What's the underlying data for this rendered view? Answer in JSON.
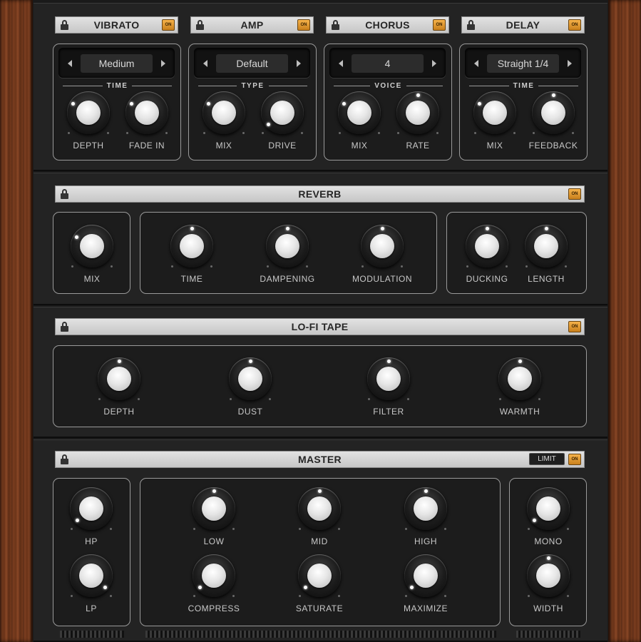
{
  "modules": {
    "vibrato": {
      "title": "VIBRATO",
      "on": "ON",
      "selector": "Medium",
      "group": "TIME",
      "knob1": "DEPTH",
      "knob2": "FADE IN"
    },
    "amp": {
      "title": "AMP",
      "on": "ON",
      "selector": "Default",
      "group": "TYPE",
      "knob1": "MIX",
      "knob2": "DRIVE"
    },
    "chorus": {
      "title": "CHORUS",
      "on": "ON",
      "selector": "4",
      "group": "VOICE",
      "knob1": "MIX",
      "knob2": "RATE"
    },
    "delay": {
      "title": "DELAY",
      "on": "ON",
      "selector": "Straight 1/4",
      "group": "TIME",
      "knob1": "MIX",
      "knob2": "FEEDBACK"
    }
  },
  "reverb": {
    "title": "REVERB",
    "on": "ON",
    "knobs": [
      "MIX",
      "TIME",
      "DAMPENING",
      "MODULATION",
      "DUCKING",
      "LENGTH"
    ]
  },
  "lofi": {
    "title": "LO-FI TAPE",
    "on": "ON",
    "knobs": [
      "DEPTH",
      "DUST",
      "FILTER",
      "WARMTH"
    ]
  },
  "master": {
    "title": "MASTER",
    "limit": "LIMIT",
    "on": "ON",
    "knobs": [
      "HP",
      "LP",
      "LOW",
      "MID",
      "HIGH",
      "COMPRESS",
      "SATURATE",
      "MAXIMIZE",
      "MONO",
      "WIDTH"
    ]
  },
  "colors": {
    "accent_on": "#e89a2c",
    "panel": "#232323",
    "titlebar": "#d4d4d4",
    "wood": "#6b3419"
  },
  "icons": {
    "lock": "lock-icon",
    "arrow_left": "arrow-left-icon",
    "arrow_right": "arrow-right-icon"
  }
}
